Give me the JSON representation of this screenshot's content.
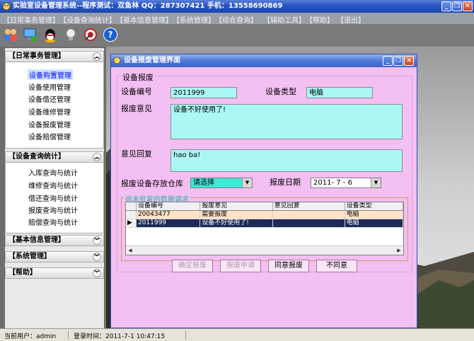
{
  "window": {
    "title": "实验室设备管理系统--程序测试：双鱼林  QQ：287307421  手机：13558690869",
    "minimize": "_",
    "restore": "❐",
    "close": "✕"
  },
  "menu": [
    "【日常事务管理】",
    "【设备查询统计】",
    "【基本信息管理】",
    "【系统管理】",
    "【综合查询】",
    "【辅助工具】",
    "【帮助】",
    "【退出】"
  ],
  "toolbar": {
    "icons": [
      "users-icon",
      "network-icon",
      "qq-icon",
      "lightbulb-icon",
      "target-icon",
      "help-icon"
    ],
    "help_glyph": "?"
  },
  "sidebar": {
    "panel1": {
      "title": "【日常事务管理】",
      "chevron": "︽",
      "items": [
        "设备购置管理",
        "设备使用管理",
        "设备借还管理",
        "设备维修管理",
        "设备报废管理",
        "设备赔偿管理"
      ]
    },
    "panel2": {
      "title": "【设备查询统计】",
      "chevron": "︽",
      "items": [
        "入库查询与统计",
        "维修查询与统计",
        "借还查询与统计",
        "报废查询与统计",
        "赔偿查询与统计"
      ]
    },
    "panel3": {
      "title": "【基本信息管理】",
      "chevron": "︾"
    },
    "panel4": {
      "title": "【系统管理】",
      "chevron": "︾"
    },
    "panel5": {
      "title": "【帮助】",
      "chevron": "︾"
    }
  },
  "dialog": {
    "title": "设备报废管理界面",
    "group_label": "设备报废",
    "device_no_label": "设备编号",
    "device_no_value": "2011999",
    "device_type_label": "设备类型",
    "device_type_value": "电脑",
    "opinion_label": "报废意见",
    "opinion_value": "设备不好使用了!",
    "reply_label": "意见回复",
    "reply_value": "hao ba!",
    "warehouse_label": "报废设备存放仓库",
    "warehouse_value": "请选择",
    "date_label": "报废日期",
    "date_value": "2011- 7 - 6",
    "pending_group_label": "尚未批复的数据请求",
    "table": {
      "columns": [
        "设备编号",
        "报废意见",
        "意见回复",
        "设备类型"
      ],
      "rows": [
        [
          "20043477",
          "需要报废",
          "",
          "电脑"
        ],
        [
          "2011999",
          "设备不好使用了!",
          "",
          "电脑"
        ]
      ],
      "selected_indicator": "▶"
    },
    "buttons": {
      "confirm": "确定报废",
      "apply": "报废申请",
      "agree": "同意报废",
      "disagree": "不同意"
    }
  },
  "status": {
    "current_user": "当前用户：admin",
    "login_time": "登录时间：2011-7-1 10:47:15"
  },
  "colors": {
    "dialog_bg": "#f4bff2",
    "field_bg": "#aaf8f4",
    "selected_row": "#1e2a55"
  }
}
